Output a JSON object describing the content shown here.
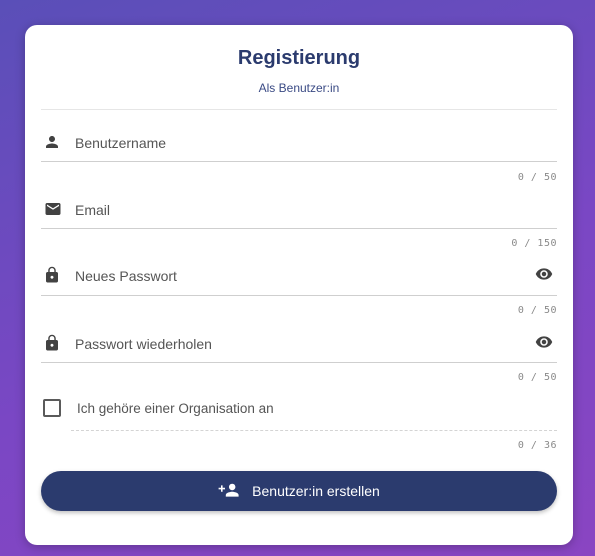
{
  "header": {
    "title": "Registierung",
    "subtitle": "Als Benutzer:in"
  },
  "form": {
    "username": {
      "label": "Benutzername",
      "counter": "0 / 50",
      "icon": "person-icon"
    },
    "email": {
      "label": "Email",
      "counter": "0 / 150",
      "icon": "mail-icon"
    },
    "password": {
      "label": "Neues Passwort",
      "counter": "0 / 50",
      "icon": "lock-icon"
    },
    "password_repeat": {
      "label": "Passwort wiederholen",
      "counter": "0 / 50",
      "icon": "lock-icon"
    },
    "organisation": {
      "label": "Ich gehöre einer Organisation an",
      "counter": "0 / 36",
      "checked": false
    },
    "submit": {
      "label": "Benutzer:in erstellen",
      "icon": "person-add-icon"
    }
  },
  "colors": {
    "primary": "#2b3b6e",
    "background": "#7a47c4"
  }
}
